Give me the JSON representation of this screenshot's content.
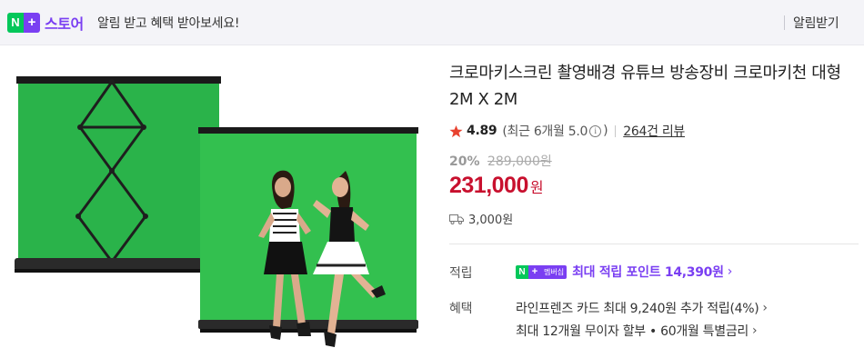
{
  "topbar": {
    "brand_badge_n": "N",
    "brand_badge_plus": "+",
    "brand_name": "스토어",
    "notice": "알림 받고 혜택 받아보세요!",
    "alert_button": "알림받기"
  },
  "product": {
    "title": "크로마키스크린 촬영배경 유튜브 방송장비 크로마키천 대형 2M X 2M",
    "rating": "4.89",
    "rating_recent": "(최근 6개월 5.0",
    "info_glyph": "i",
    "rating_close": ")",
    "review_count": "264건 리뷰",
    "discount_rate": "20%",
    "original_price": "289,000원",
    "sale_price": "231,000",
    "currency": "원",
    "shipping_fee": "3,000원"
  },
  "benefits": {
    "points_label": "적립",
    "membership_badge_n": "N",
    "membership_badge_plus": "+",
    "membership_badge_text": "멤버십",
    "points_text": "최대 적립 포인트 14,390원",
    "benefit_label": "혜택",
    "benefit_line1": "라인프렌즈 카드 최대 9,240원 추가 적립(4%)",
    "benefit_line2": "최대 12개월 무이자 할부 • 60개월 특별금리",
    "chevron": "›"
  },
  "colors": {
    "brand_green": "#03c75a",
    "brand_purple": "#7a3ff2",
    "price_red": "#c8102e",
    "star_red": "#e8422f",
    "chroma_green": "#2cb84a"
  },
  "icons": [
    "star-icon",
    "info-icon",
    "truck-icon",
    "chevron-right-icon"
  ]
}
